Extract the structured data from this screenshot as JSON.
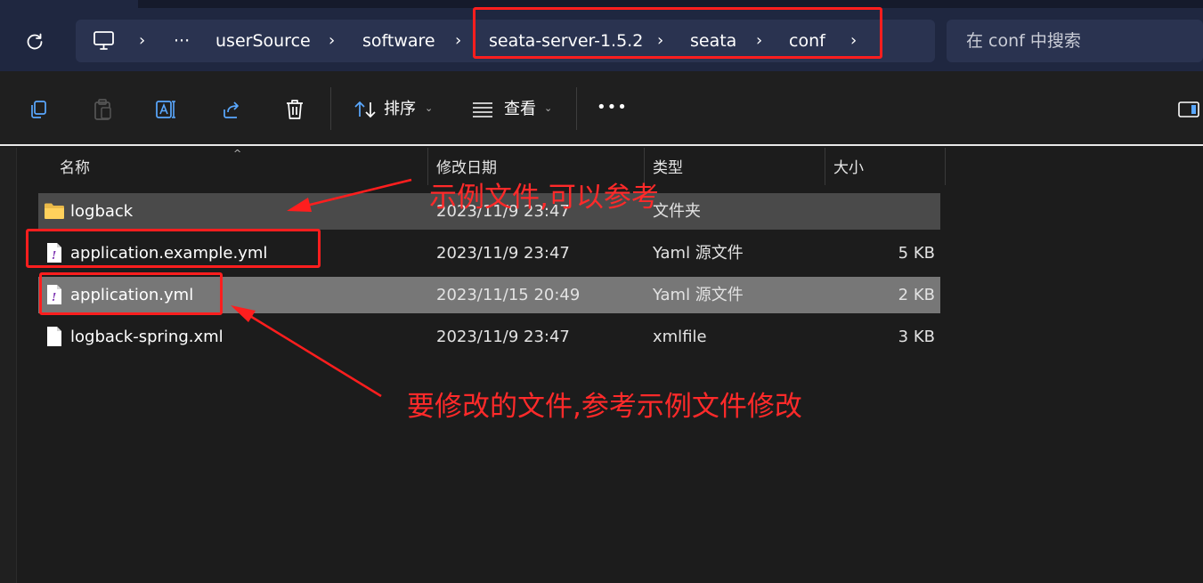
{
  "address_bar": {
    "breadcrumbs": [
      {
        "label": "···"
      },
      {
        "label": "userSource"
      },
      {
        "label": "software"
      },
      {
        "label": "seata-server-1.5.2"
      },
      {
        "label": "seata"
      },
      {
        "label": "conf"
      }
    ],
    "search_placeholder": "在 conf 中搜索"
  },
  "toolbar": {
    "sort_label": "排序",
    "view_label": "查看",
    "more_label": "•••"
  },
  "columns": {
    "name": "名称",
    "modified": "修改日期",
    "type": "类型",
    "size": "大小"
  },
  "files": [
    {
      "name": "logback",
      "modified": "2023/11/9 23:47",
      "type": "文件夹",
      "size": "",
      "icon": "folder-icon"
    },
    {
      "name": "application.example.yml",
      "modified": "2023/11/9 23:47",
      "type": "Yaml 源文件",
      "size": "5 KB",
      "icon": "yaml-file-icon"
    },
    {
      "name": "application.yml",
      "modified": "2023/11/15 20:49",
      "type": "Yaml 源文件",
      "size": "2 KB",
      "icon": "yaml-file-icon"
    },
    {
      "name": "logback-spring.xml",
      "modified": "2023/11/9 23:47",
      "type": "xmlfile",
      "size": "3 KB",
      "icon": "file-icon"
    }
  ],
  "annotations": {
    "example_note": "示例文件,可以参考",
    "edit_note": "要修改的文件,参考示例文件修改"
  },
  "colors": {
    "annotation_red": "#ff1e1e",
    "address_bg": "#1f2740",
    "selected_row": "#777777",
    "hover_row": "#4a4a4a"
  }
}
